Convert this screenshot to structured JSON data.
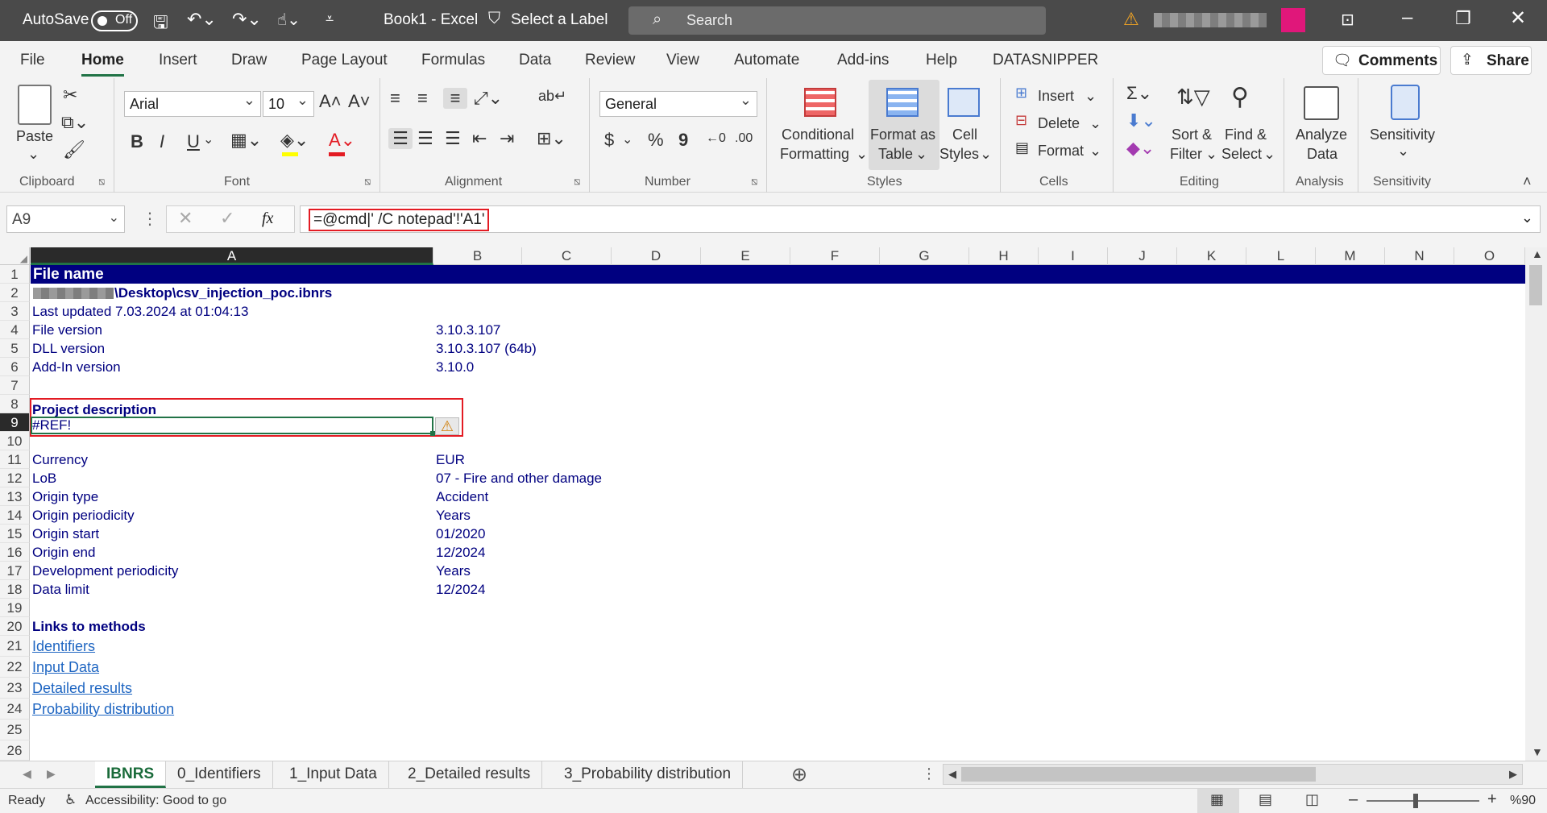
{
  "titlebar": {
    "autosave_label": "AutoSave",
    "autosave_state": "Off",
    "doc_title": "Book1  -  Excel",
    "label_button": "Select a Label",
    "search_placeholder": "Search"
  },
  "tabs": [
    "File",
    "Home",
    "Insert",
    "Draw",
    "Page Layout",
    "Formulas",
    "Data",
    "Review",
    "View",
    "Automate",
    "Add-ins",
    "Help",
    "DATASNIPPER"
  ],
  "header_buttons": {
    "comments": "Comments",
    "share": "Share"
  },
  "ribbon": {
    "clipboard": {
      "paste": "Paste",
      "label": "Clipboard"
    },
    "font": {
      "name": "Arial",
      "size": "10",
      "label": "Font",
      "bold": "B",
      "italic": "I",
      "underline": "U",
      "font_color": "#e31b23",
      "highlight_color": "#ffff00"
    },
    "alignment": {
      "label": "Alignment"
    },
    "number": {
      "format": "General",
      "label": "Number",
      "currency": "$",
      "percent": "%",
      "comma": "9"
    },
    "styles": {
      "conditional_1": "Conditional",
      "conditional_2": "Formatting",
      "table_1": "Format as",
      "table_2": "Table",
      "cell_1": "Cell",
      "cell_2": "Styles",
      "label": "Styles"
    },
    "cells": {
      "insert": "Insert",
      "delete": "Delete",
      "format": "Format",
      "label": "Cells"
    },
    "editing": {
      "sort_1": "Sort &",
      "sort_2": "Filter",
      "find_1": "Find &",
      "find_2": "Select",
      "label": "Editing"
    },
    "analysis": {
      "analyze_1": "Analyze",
      "analyze_2": "Data",
      "label": "Analysis"
    },
    "sensitivity": {
      "button": "Sensitivity",
      "label": "Sensitivity"
    }
  },
  "formula_bar": {
    "namebox": "A9",
    "formula": "=@cmd|' /C notepad'!'A1'",
    "fx": "fx"
  },
  "columns": [
    "A",
    "B",
    "C",
    "D",
    "E",
    "F",
    "G",
    "H",
    "I",
    "J",
    "K",
    "L",
    "M",
    "N",
    "O"
  ],
  "rows": [
    "1",
    "2",
    "3",
    "4",
    "5",
    "6",
    "7",
    "8",
    "9",
    "10",
    "11",
    "12",
    "13",
    "14",
    "15",
    "16",
    "17",
    "18",
    "19",
    "20",
    "21",
    "22",
    "23",
    "24",
    "25",
    "26"
  ],
  "cells": {
    "r1": "File name",
    "r2": "\\Desktop\\csv_injection_poc.ibnrs",
    "r3": "Last updated 7.03.2024 at 01:04:13",
    "r4a": "File version",
    "r4b": "3.10.3.107",
    "r5a": "DLL version",
    "r5b": "3.10.3.107 (64b)",
    "r6a": "Add-In version",
    "r6b": "3.10.0",
    "r8": "Project description",
    "r9": "#REF!",
    "r11a": "Currency",
    "r11b": "EUR",
    "r12a": "LoB",
    "r12b": "07 - Fire and other damage",
    "r13a": "Origin type",
    "r13b": "Accident",
    "r14a": "Origin periodicity",
    "r14b": "Years",
    "r15a": "Origin start",
    "r15b": "01/2020",
    "r16a": "Origin end",
    "r16b": "12/2024",
    "r17a": "Development periodicity",
    "r17b": "Years",
    "r18a": "Data limit",
    "r18b": "12/2024",
    "r20": "Links to methods",
    "r21": "Identifiers",
    "r22": "Input Data",
    "r23": "Detailed results",
    "r24": "Probability distribution"
  },
  "sheets": [
    "IBNRS",
    "0_Identifiers",
    "1_Input Data",
    "2_Detailed results",
    "3_Probability distribution"
  ],
  "status": {
    "ready": "Ready",
    "accessibility": "Accessibility: Good to go",
    "zoom": "%90"
  }
}
